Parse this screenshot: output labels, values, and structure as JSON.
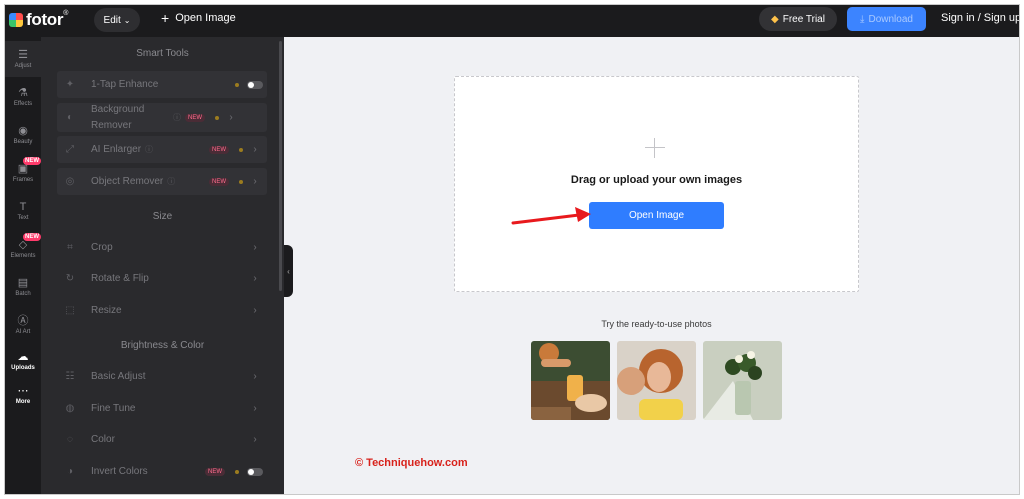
{
  "header": {
    "logo": "fotor",
    "logo_mark": "®",
    "edit_label": "Edit",
    "open_label": "Open Image",
    "free_trial_label": "Free Trial",
    "download_label": "Download",
    "signin_label": "Sign in / Sign up"
  },
  "rail": [
    {
      "label": "Adjust",
      "icon": "sliders-icon",
      "glyph": "☰"
    },
    {
      "label": "Effects",
      "icon": "flask-icon",
      "glyph": "⚗"
    },
    {
      "label": "Beauty",
      "icon": "eye-icon",
      "glyph": "◉"
    },
    {
      "label": "Frames",
      "icon": "frame-icon",
      "glyph": "▣",
      "badge": "NEW"
    },
    {
      "label": "Text",
      "icon": "text-icon",
      "glyph": "T"
    },
    {
      "label": "Elements",
      "icon": "elements-icon",
      "glyph": "◇",
      "badge": "NEW"
    },
    {
      "label": "Batch",
      "icon": "batch-icon",
      "glyph": "▤"
    },
    {
      "label": "AI Art",
      "icon": "ai-art-icon",
      "glyph": "Ⓐ"
    },
    {
      "label": "Uploads",
      "icon": "cloud-upload-icon",
      "glyph": "☁"
    },
    {
      "label": "More",
      "icon": "more-icon",
      "glyph": "⋯"
    }
  ],
  "panel": {
    "smart_tools_title": "Smart Tools",
    "size_title": "Size",
    "brightness_title": "Brightness & Color",
    "smart_tools": [
      {
        "label": "1-Tap Enhance"
      },
      {
        "label": "Background Remover",
        "badge": "NEW"
      },
      {
        "label": "AI Enlarger",
        "badge": "NEW"
      },
      {
        "label": "Object Remover",
        "badge": "NEW"
      }
    ],
    "size_tools": [
      "Crop",
      "Rotate & Flip",
      "Resize"
    ],
    "color_tools": [
      {
        "label": "Basic Adjust"
      },
      {
        "label": "Fine Tune"
      },
      {
        "label": "Color"
      },
      {
        "label": "Invert Colors",
        "badge": "NEW"
      }
    ]
  },
  "canvas": {
    "drag_text": "Drag or upload your own images",
    "open_button": "Open Image",
    "try_text": "Try the ready-to-use photos"
  },
  "watermark": "© Techniquehow.com",
  "colors": {
    "accent": "#2f7dff",
    "dark_bg": "#1b1b1d",
    "panel_bg": "#2a2a2d",
    "arrow": "#e8191d"
  }
}
